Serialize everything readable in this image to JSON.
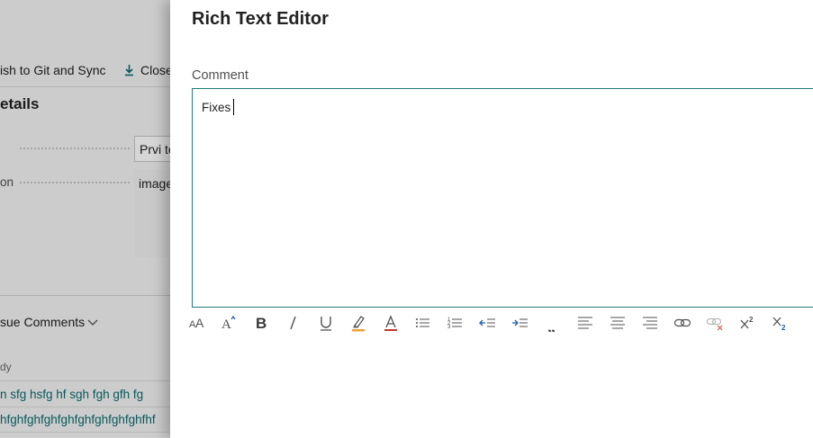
{
  "background": {
    "actions": {
      "publish_label": "ish to Git and Sync",
      "close_label": "Close"
    },
    "details_title": "etails",
    "rows": [
      {
        "label": "",
        "value": "Prvi te"
      },
      {
        "label": "on",
        "value": "image"
      }
    ],
    "issue_comments_label": "sue Comments",
    "column_header": "dy",
    "comment_rows": [
      "n sfg hsfg hf sgh fgh gfh fg",
      "hfghfghfghfghfghfghfghfghfhf"
    ]
  },
  "dialog": {
    "title": "Rich Text Editor",
    "field_label": "Comment",
    "editor_value": "Fixes"
  },
  "toolbar": {
    "buttons": [
      {
        "name": "font-size-icon",
        "label": "Font size"
      },
      {
        "name": "font-icon",
        "label": "Font"
      },
      {
        "name": "bold-icon",
        "label": "Bold",
        "glyph": "B"
      },
      {
        "name": "italic-icon",
        "label": "Italic",
        "glyph": "/"
      },
      {
        "name": "underline-icon",
        "label": "Underline",
        "glyph": "U"
      },
      {
        "name": "highlight-icon",
        "label": "Highlight color"
      },
      {
        "name": "font-color-icon",
        "label": "Font color",
        "glyph": "A"
      },
      {
        "name": "bullet-list-icon",
        "label": "Bullets"
      },
      {
        "name": "numbered-list-icon",
        "label": "Numbering"
      },
      {
        "name": "decrease-indent-icon",
        "label": "Decrease indent"
      },
      {
        "name": "increase-indent-icon",
        "label": "Increase indent"
      },
      {
        "name": "quote-icon",
        "label": "Quote",
        "glyph": "„"
      },
      {
        "name": "align-left-icon",
        "label": "Align left"
      },
      {
        "name": "align-center-icon",
        "label": "Align center"
      },
      {
        "name": "align-right-icon",
        "label": "Align right"
      },
      {
        "name": "link-icon",
        "label": "Insert link"
      },
      {
        "name": "unlink-icon",
        "label": "Remove link"
      },
      {
        "name": "superscript-icon",
        "label": "Superscript"
      },
      {
        "name": "subscript-icon",
        "label": "Subscript"
      }
    ]
  },
  "colors": {
    "accent": "#1f7d76",
    "link": "#0a6a6e",
    "icon": "#505050",
    "icon_blue": "#1f5ba8",
    "highlight": "#f0a030",
    "font_color": "#c0392b",
    "unlink_red": "#e05050"
  }
}
